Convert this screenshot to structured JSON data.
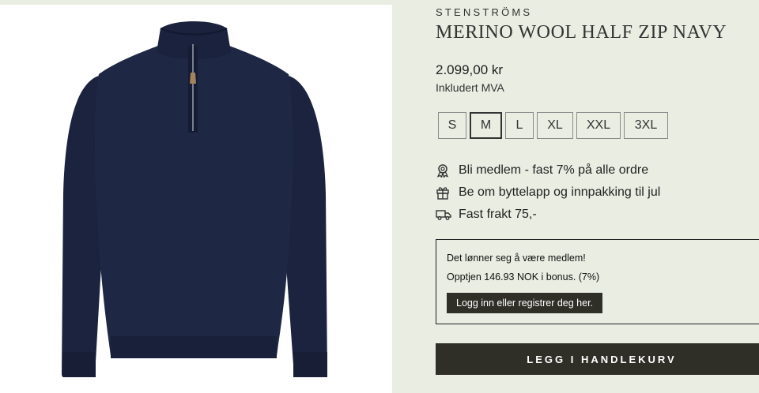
{
  "product": {
    "brand": "STENSTRÖMS",
    "title": "MERINO WOOL HALF ZIP NAVY",
    "price": "2.099,00 kr",
    "vat_note": "Inkludert MVA",
    "image_color": "#1c2440"
  },
  "sizes": [
    {
      "label": "S",
      "selected": false
    },
    {
      "label": "M",
      "selected": true
    },
    {
      "label": "L",
      "selected": false
    },
    {
      "label": "XL",
      "selected": false
    },
    {
      "label": "XXL",
      "selected": false
    },
    {
      "label": "3XL",
      "selected": false
    }
  ],
  "perks": [
    {
      "icon": "award-ribbon-icon",
      "text": "Bli medlem - fast 7% på alle ordre"
    },
    {
      "icon": "gift-icon",
      "text": "Be om byttelapp og innpakking til jul"
    },
    {
      "icon": "delivery-truck-icon",
      "text": "Fast frakt 75,-"
    }
  ],
  "membership": {
    "heading": "Det lønner seg å være medlem!",
    "bonus_text": "Opptjen 146.93 NOK i bonus. (7%)",
    "login_label": "Logg inn eller registrer deg her."
  },
  "cart": {
    "label": "LEGG I HANDLEKURV"
  },
  "colors": {
    "background": "#e9ede2",
    "button": "#2f2f28",
    "sweater": "#1c2440"
  }
}
